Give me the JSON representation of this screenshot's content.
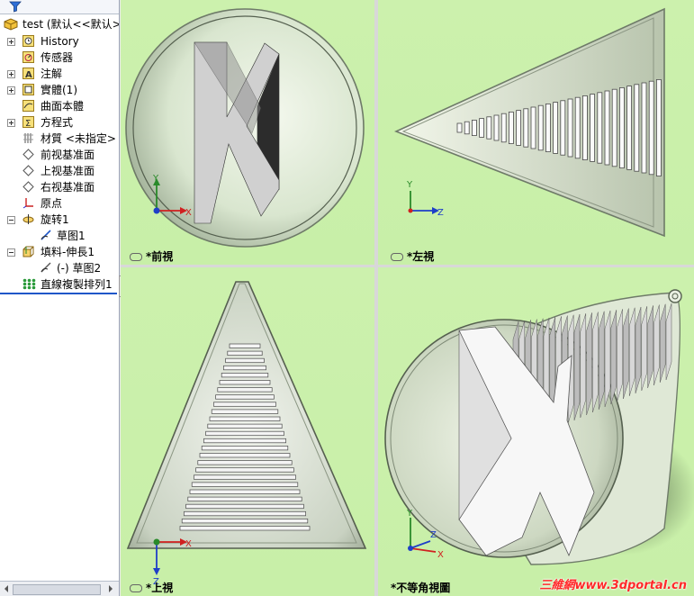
{
  "tree": {
    "root": "test (默认<<默认>",
    "items": [
      {
        "label": "History",
        "icon": "history-icon"
      },
      {
        "label": "传感器",
        "icon": "sensor-icon"
      },
      {
        "label": "注解",
        "icon": "annotation-icon"
      },
      {
        "label": "實體(1)",
        "icon": "solid-body-icon"
      },
      {
        "label": "曲面本體",
        "icon": "surface-body-icon"
      },
      {
        "label": "方程式",
        "icon": "equation-icon"
      },
      {
        "label": "材質 <未指定>",
        "icon": "material-icon"
      },
      {
        "label": "前视基准面",
        "icon": "plane-icon"
      },
      {
        "label": "上视基准面",
        "icon": "plane-icon"
      },
      {
        "label": "右视基准面",
        "icon": "plane-icon"
      },
      {
        "label": "原点",
        "icon": "origin-icon"
      },
      {
        "label": "旋转1",
        "icon": "revolve-icon"
      },
      {
        "label": "草图1",
        "icon": "sketch-icon"
      },
      {
        "label": "填料-伸長1",
        "icon": "extrude-icon"
      },
      {
        "label": "(-) 草图2",
        "icon": "sketch-icon"
      },
      {
        "label": "直線複製排列1",
        "icon": "linear-pattern-icon"
      }
    ]
  },
  "views": {
    "front": "*前視",
    "left": "*左視",
    "top": "*上視",
    "iso": "*不等角視圖"
  },
  "axes": {
    "x": "X",
    "y": "Y",
    "z": "Z"
  },
  "watermark": "三維網www.3dportal.cn",
  "colors": {
    "viewport_bg": "#ccf1ad",
    "accent": "#1f56c8",
    "watermark": "#ff2a2a"
  }
}
